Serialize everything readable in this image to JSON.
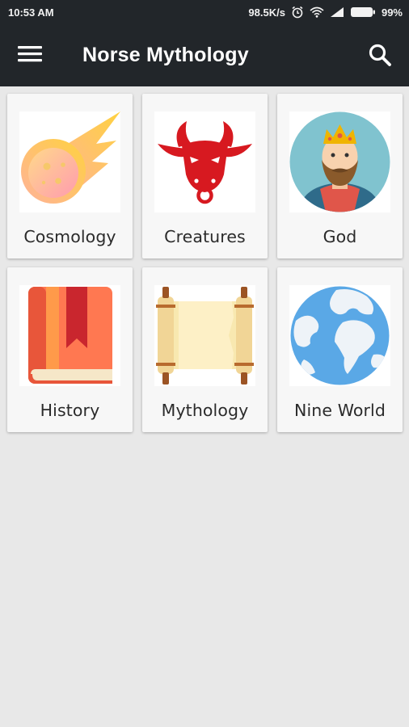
{
  "status_bar": {
    "time": "10:53 AM",
    "network_speed": "98.5K/s",
    "battery_percent": "99%",
    "icons": [
      "alarm-icon",
      "wifi-icon",
      "signal-icon",
      "battery-icon"
    ]
  },
  "app_bar": {
    "title": "Norse Mythology",
    "menu_icon": "hamburger-menu-icon",
    "search_icon": "search-icon",
    "background": "#22262a"
  },
  "categories": [
    {
      "label": "Cosmology",
      "icon": "meteor-icon"
    },
    {
      "label": "Creatures",
      "icon": "bull-head-icon"
    },
    {
      "label": "God",
      "icon": "king-avatar-icon"
    },
    {
      "label": "History",
      "icon": "book-icon"
    },
    {
      "label": "Mythology",
      "icon": "scroll-icon"
    },
    {
      "label": "Nine World",
      "icon": "globe-icon"
    }
  ]
}
